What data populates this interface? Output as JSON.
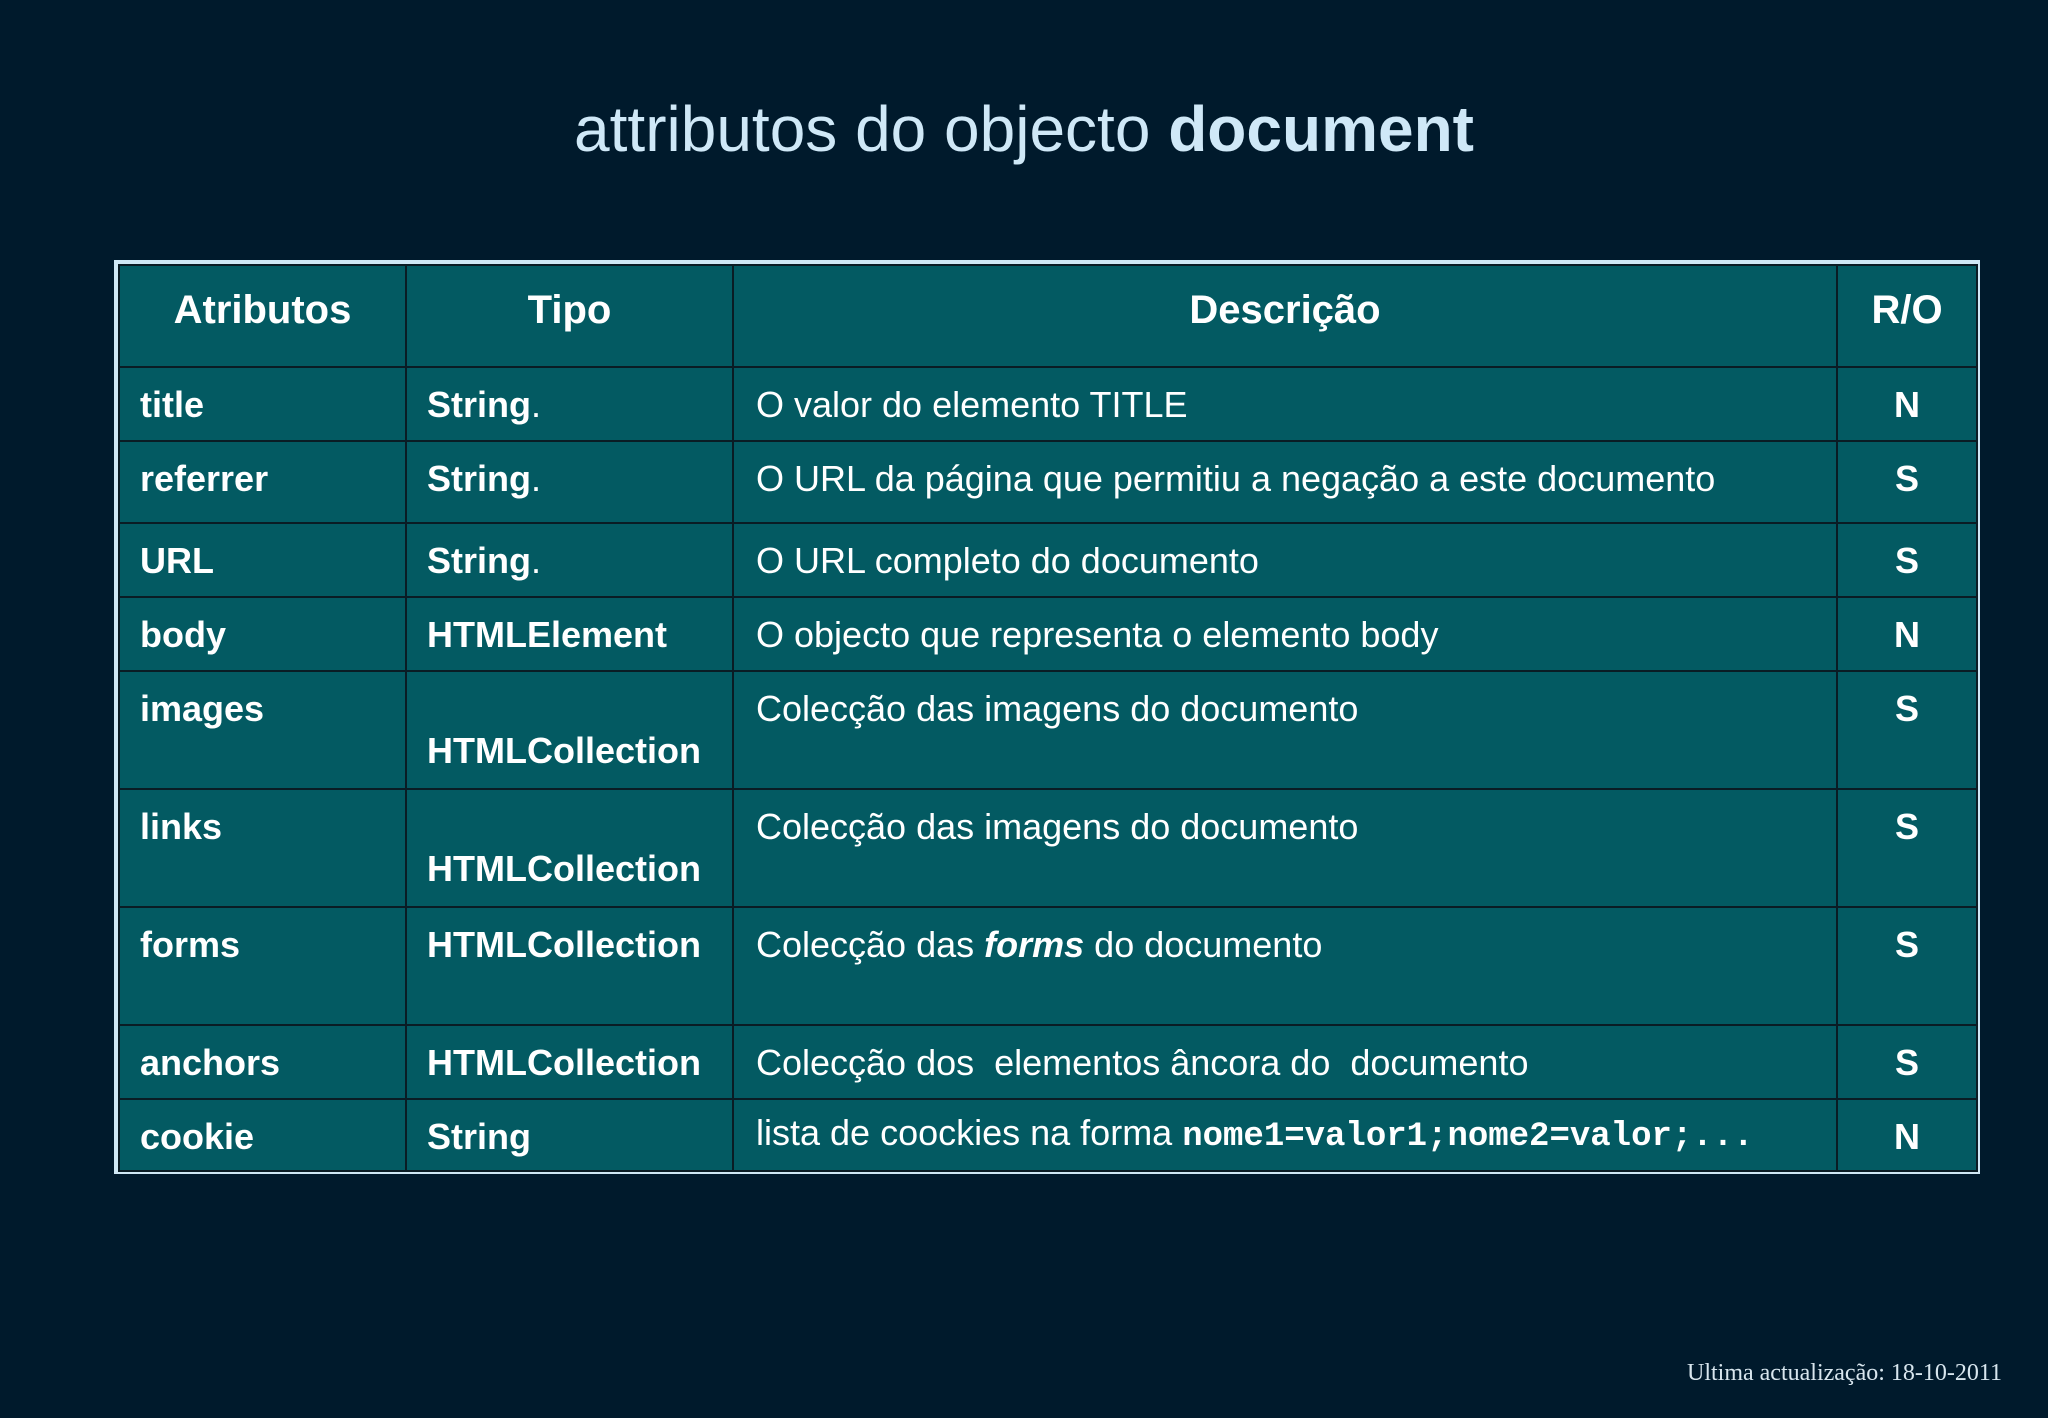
{
  "slide": {
    "title_normal": "attributos do objecto ",
    "title_strong": "document",
    "footer": "Ultima actualização: 18-10-2011"
  },
  "table": {
    "headers": [
      "Atributos",
      "Tipo",
      "Descrição",
      "R/O"
    ],
    "rows": [
      {
        "attr": "title",
        "tipo": "String",
        "tipo_suffix": ".",
        "desc": "O valor do elemento TITLE",
        "ro": "N"
      },
      {
        "attr": "referrer",
        "tipo": "String",
        "tipo_suffix": ".",
        "desc": "O URL da página que permitiu a negação a este documento",
        "ro": "S"
      },
      {
        "attr": "URL",
        "tipo": "String",
        "tipo_suffix": ".",
        "desc": "O URL completo do documento",
        "ro": "S"
      },
      {
        "attr": "body",
        "tipo": "HTMLElement",
        "desc": "O objecto que representa o elemento body",
        "ro": "N"
      },
      {
        "attr": "images",
        "tipo": "HTMLCollection",
        "desc": "Colecção das imagens do documento",
        "ro": "S"
      },
      {
        "attr": "links",
        "tipo": "HTMLCollection",
        "desc": "Colecção das imagens do documento",
        "ro": "S"
      },
      {
        "attr": "forms",
        "tipo": "HTMLCollection",
        "desc_pre": "Colecção das ",
        "desc_em": "forms",
        "desc_post": " do documento",
        "ro": "S"
      },
      {
        "attr": "anchors",
        "tipo": "HTMLCollection",
        "desc": "Colecção dos  elementos âncora do  documento",
        "ro": "S"
      },
      {
        "attr": "cookie",
        "tipo": "String",
        "desc_pre": "lista de coockies na forma ",
        "desc_code": "nome1=valor1;nome2=valor;...",
        "ro": "N"
      }
    ]
  }
}
